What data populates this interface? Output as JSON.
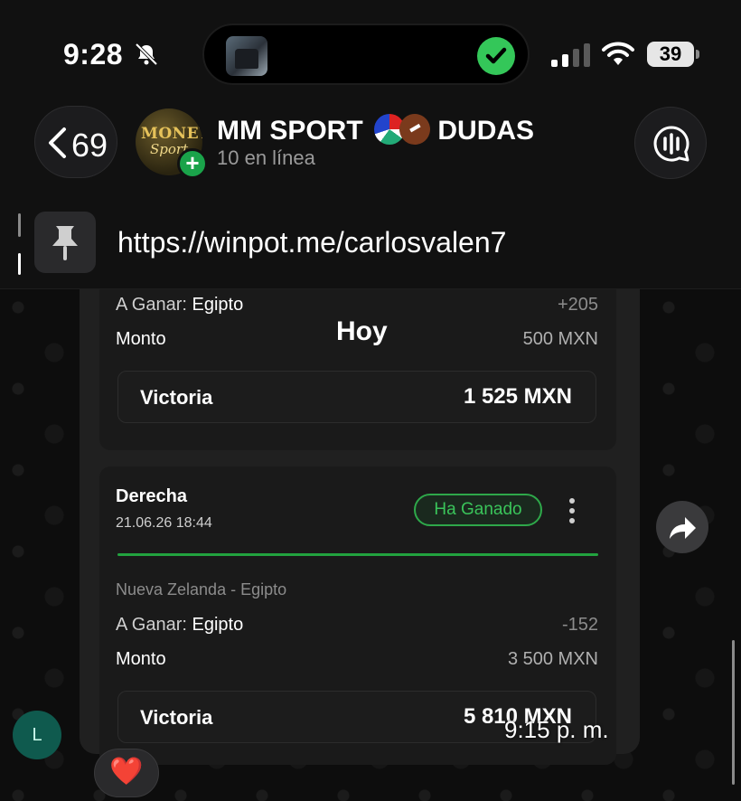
{
  "status_bar": {
    "time": "9:28",
    "battery_level": "39",
    "icons": [
      "bell-slash-icon",
      "cellular-signal-icon",
      "wifi-icon",
      "battery-icon"
    ]
  },
  "dynamic_island": {
    "status_icon": "checkmark-icon",
    "status_color": "#34c759"
  },
  "chat_header": {
    "back_count": "69",
    "group_name": "MM SPORT",
    "group_name_suffix": "DUDAS",
    "subtitle": "10 en línea",
    "avatar_lettering": [
      "MONEY",
      "Sport"
    ]
  },
  "pinned": {
    "text": "https://winpot.me/carlosvalen7"
  },
  "chat": {
    "day_label": "Hoy",
    "message_time": "9:15 p. m.",
    "sender_initial": "L",
    "reaction": "❤️"
  },
  "bet_card_1": {
    "to_win_label": "A Ganar:",
    "to_win_team": "Egipto",
    "odds": "+205",
    "amount_label": "Monto",
    "amount": "500 MXN",
    "victory_label": "Victoria",
    "victory_amount": "1 525 MXN"
  },
  "bet_card_2": {
    "title": "Derecha",
    "date": "21.06.26 18:44",
    "status": "Ha Ganado",
    "match": "Nueva Zelanda - Egipto",
    "to_win_label": "A Ganar:",
    "to_win_team": "Egipto",
    "odds": "-152",
    "amount_label": "Monto",
    "amount": "3 500 MXN",
    "victory_label": "Victoria",
    "victory_amount": "5 810 MXN"
  },
  "colors": {
    "accent_green": "#22a33f",
    "status_text_green": "#3ac45a",
    "heart_red": "#e3262b"
  }
}
